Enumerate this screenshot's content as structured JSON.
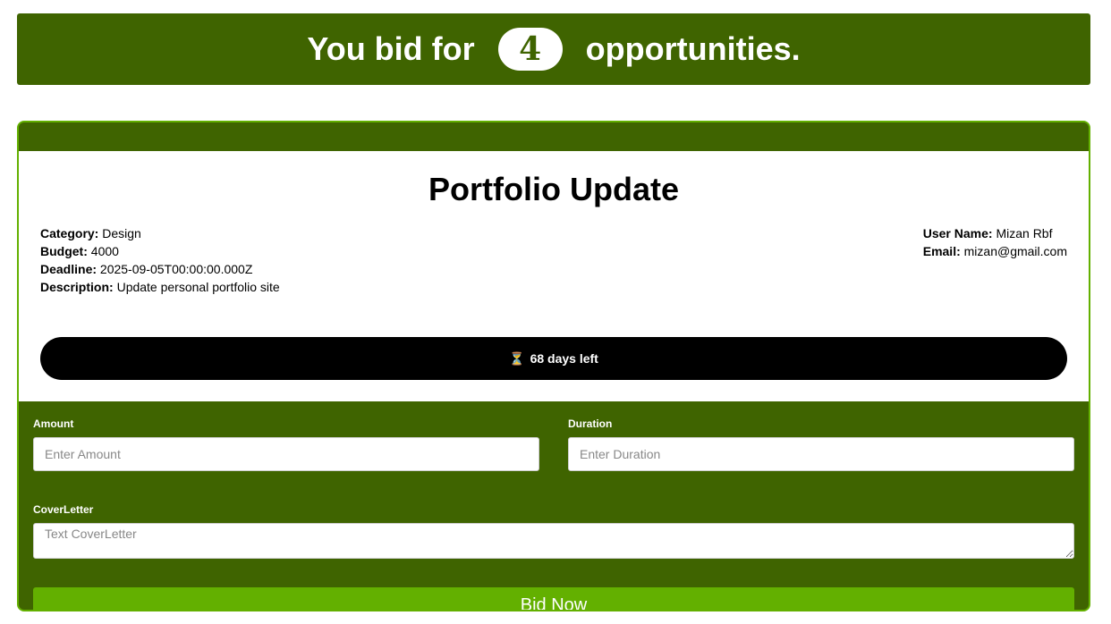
{
  "banner": {
    "prefix": "You bid for",
    "count": "4",
    "suffix": "opportunities."
  },
  "job": {
    "title": "Portfolio Update",
    "category_label": "Category:",
    "category": "Design",
    "budget_label": "Budget:",
    "budget": "4000",
    "deadline_label": "Deadline:",
    "deadline": "2025-09-05T00:00:00.000Z",
    "description_label": "Description:",
    "description": "Update personal portfolio site",
    "user_name_label": "User Name:",
    "user_name": "Mizan Rbf",
    "email_label": "Email:",
    "email": "mizan@gmail.com",
    "timer_icon": "⏳",
    "timer_text": "68 days left"
  },
  "form": {
    "amount_label": "Amount",
    "amount_placeholder": "Enter Amount",
    "duration_label": "Duration",
    "duration_placeholder": "Enter Duration",
    "cover_letter_label": "CoverLetter",
    "cover_letter_placeholder": "Text CoverLetter",
    "submit_label": "Bid Now"
  },
  "colors": {
    "primary_dark": "#3f6400",
    "primary_light": "#63b000",
    "timer_bg": "#000000"
  },
  "icons": {
    "timer": "hourglass-icon"
  }
}
